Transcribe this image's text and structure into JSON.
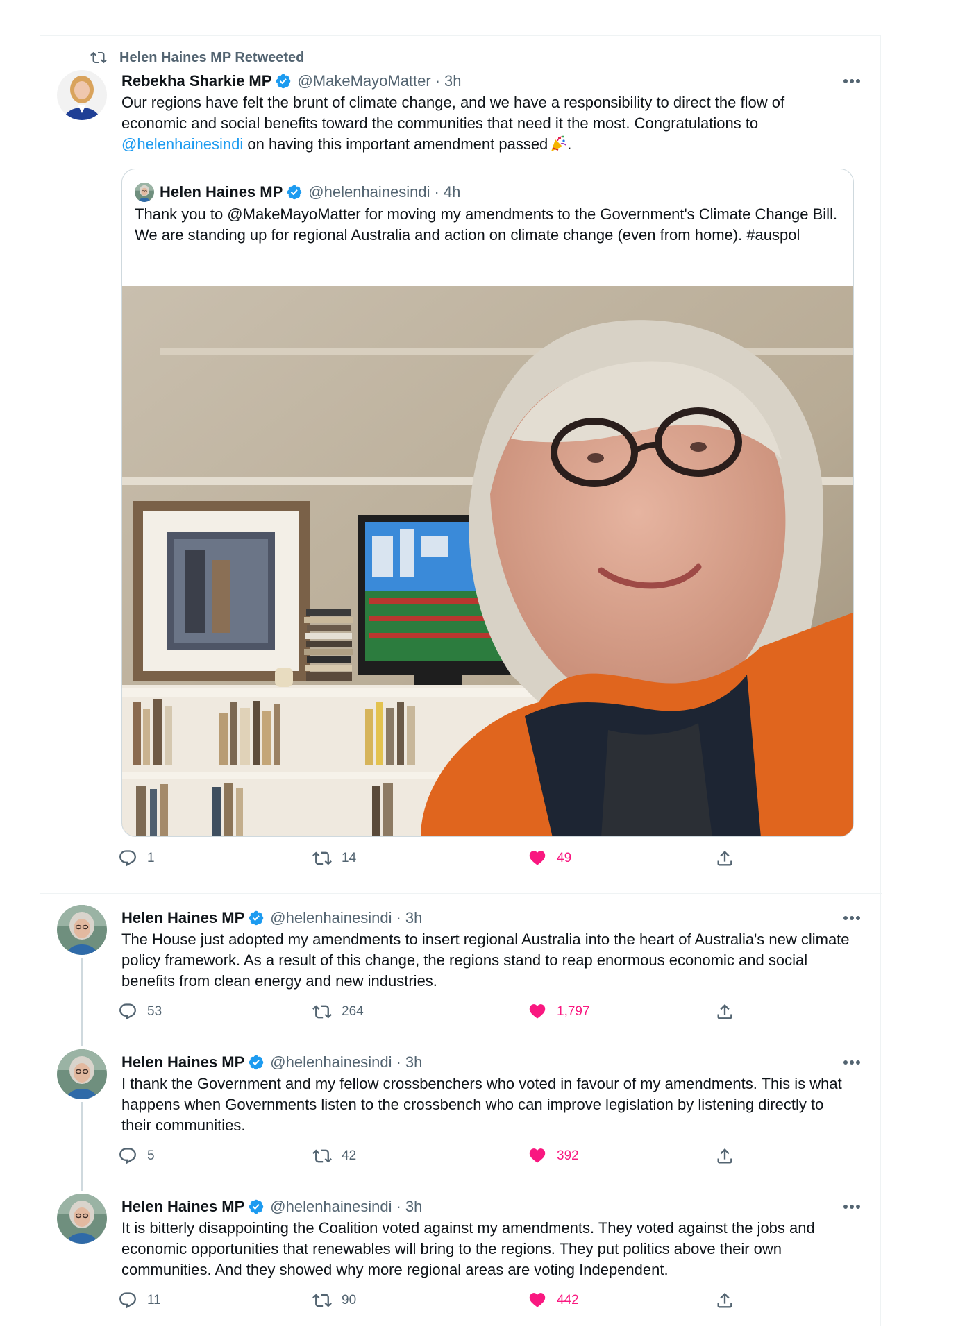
{
  "colors": {
    "accent": "#1d9bf0",
    "like": "#f91880",
    "muted": "#536471",
    "text": "#0f1419",
    "border": "#eff3f4"
  },
  "tweets": [
    {
      "retweeted_by": "Helen Haines MP Retweeted",
      "author": {
        "name": "Rebekha Sharkie MP",
        "handle": "@MakeMayoMatter",
        "verified": true,
        "avatar": "woman-blue-blazer-avatar"
      },
      "separator": "·",
      "time": "3h",
      "text_parts": [
        "Our regions have felt the brunt of climate change, and we have a responsibility to direct the flow of economic and social benefits toward the communities that need it the most. Congratulations to ",
        "@helenhainesindi",
        " on having this important amendment passed",
        "."
      ],
      "emoji": "party-popper-icon",
      "quote": {
        "author": {
          "name": "Helen Haines MP",
          "handle": "@helenhainesindi",
          "verified": true
        },
        "separator": "·",
        "time": "4h",
        "text": "Thank you to @MakeMayoMatter for moving my amendments to the Government's Climate Change Bill. We are standing up for regional Australia and action on climate change (even from home). #auspol",
        "image": "selfie-in-front-of-tv-showing-parliament"
      },
      "stats": {
        "replies": "1",
        "retweets": "14",
        "likes": "49",
        "liked": true
      }
    },
    {
      "author": {
        "name": "Helen Haines MP",
        "handle": "@helenhainesindi",
        "verified": true,
        "avatar": "woman-grey-hair-avatar"
      },
      "separator": "·",
      "time": "3h",
      "text": "The House just adopted my amendments to insert regional Australia into the heart of Australia's new climate policy framework. As a result of this change, the regions stand to reap enormous economic and social benefits from clean energy and new industries.",
      "stats": {
        "replies": "53",
        "retweets": "264",
        "likes": "1,797",
        "liked": true
      }
    },
    {
      "author": {
        "name": "Helen Haines MP",
        "handle": "@helenhainesindi",
        "verified": true,
        "avatar": "woman-grey-hair-avatar"
      },
      "separator": "·",
      "time": "3h",
      "text": "I thank the Government and my fellow crossbenchers who voted in favour of my amendments. This is what happens when Governments listen to the crossbench who can improve legislation by listening directly to their communities.",
      "stats": {
        "replies": "5",
        "retweets": "42",
        "likes": "392",
        "liked": true
      }
    },
    {
      "author": {
        "name": "Helen Haines MP",
        "handle": "@helenhainesindi",
        "verified": true,
        "avatar": "woman-grey-hair-avatar"
      },
      "separator": "·",
      "time": "3h",
      "text": "It is bitterly disappointing the Coalition voted against my amendments. They voted against the jobs and economic opportunities that renewables will bring to the regions. They put politics above their own communities. And they showed why more regional areas are voting Independent.",
      "stats": {
        "replies": "11",
        "retweets": "90",
        "likes": "442",
        "liked": true
      }
    }
  ]
}
